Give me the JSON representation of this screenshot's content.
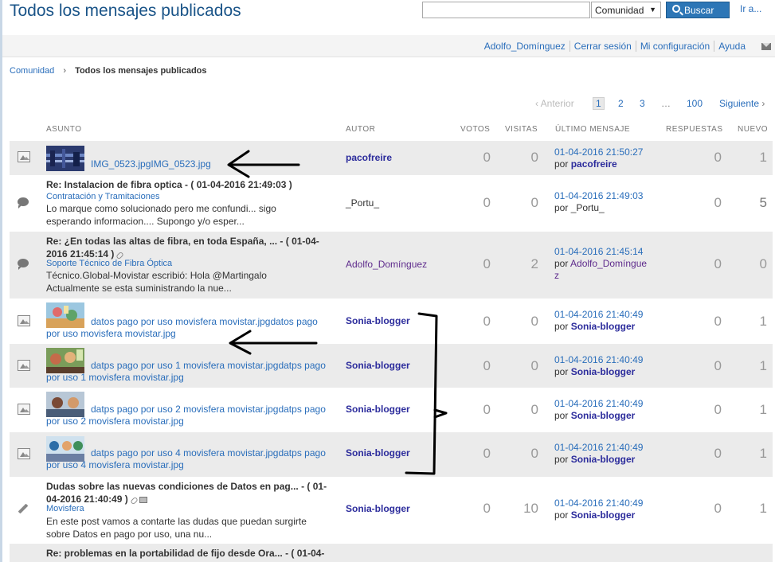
{
  "header": {
    "title": "Todos los mensajes publicados",
    "search_placeholder": "",
    "scope": "Comunidad",
    "search_button": "Buscar",
    "goto": "Ir a..."
  },
  "userbar": {
    "user": "Adolfo_Domínguez",
    "logout": "Cerrar sesión",
    "settings": "Mi configuración",
    "help": "Ayuda"
  },
  "breadcrumb": {
    "root": "Comunidad",
    "current": "Todos los mensajes publicados"
  },
  "pagination": {
    "prev": "Anterior",
    "current": "1",
    "pages": [
      "2",
      "3"
    ],
    "ellipsis": "…",
    "last": "100",
    "next": "Siguiente"
  },
  "columns": {
    "subject": "ASUNTO",
    "author": "AUTOR",
    "votes": "VOTOS",
    "views": "VISITAS",
    "last": "ÚLTIMO MENSAJE",
    "replies": "RESPUESTAS",
    "new": "NUEVO"
  },
  "rows": [
    {
      "icon": "image-icon",
      "subject": "IMG_0523.jpgIMG_0523.jpg",
      "author": "pacofreire",
      "votes": "0",
      "views": "0",
      "last_date": "01-04-2016 21:50:27",
      "by": "por",
      "last_user": "pacofreire",
      "replies": "0",
      "new": "1"
    },
    {
      "icon": "speech-bubble-icon",
      "title": "Re: Instalacion de fibra optica - ( 01-04-2016 21:49:03 )",
      "board": "Contratación y Tramitaciones",
      "snippet": "Lo marque como solucionado pero me confundi... sigo esperando informacion....   Supongo y/o esper...",
      "author": "_Portu_",
      "votes": "0",
      "views": "0",
      "last_date": "01-04-2016 21:49:03",
      "by": "por",
      "last_user": "_Portu_",
      "replies": "0",
      "new": "5"
    },
    {
      "icon": "speech-bubble-icon",
      "title_line1": "Re: ¿En todas las altas de fibra, en toda España, ... - ( 01-04-",
      "title_line2": "2016 21:45:14 )",
      "board": "Soporte Técnico de Fibra Óptica",
      "snippet": "Técnico.Global-Movistar escribió: Hola @Martingalo Actualmente se esta suministrando la nue...",
      "author": "Adolfo_Domínguez",
      "votes": "0",
      "views": "2",
      "last_date": "01-04-2016 21:45:14",
      "by": "por",
      "last_user_line1": "Adolfo_Domíngue",
      "last_user_line2": "z",
      "replies": "0",
      "new": "0"
    },
    {
      "icon": "image-icon",
      "subject_line1": "datos pago por uso movisfera movistar.jpgdatos pago",
      "subject_line2": "por uso movisfera movistar.jpg",
      "author": "Sonia-blogger",
      "votes": "0",
      "views": "0",
      "last_date": "01-04-2016 21:40:49",
      "by": "por",
      "last_user": "Sonia-blogger",
      "replies": "0",
      "new": "1"
    },
    {
      "icon": "image-icon",
      "subject_line1": "datps pago por uso 1 movisfera movistar.jpgdatps",
      "subject_line2": "pago por uso 1 movisfera movistar.jpg",
      "author": "Sonia-blogger",
      "votes": "0",
      "views": "0",
      "last_date": "01-04-2016 21:40:49",
      "by": "por",
      "last_user": "Sonia-blogger",
      "replies": "0",
      "new": "1"
    },
    {
      "icon": "image-icon",
      "subject_line1": "datps pago por uso 2 movisfera movistar.jpgdatps",
      "subject_line2": "pago por uso 2 movisfera movistar.jpg",
      "author": "Sonia-blogger",
      "votes": "0",
      "views": "0",
      "last_date": "01-04-2016 21:40:49",
      "by": "por",
      "last_user": "Sonia-blogger",
      "replies": "0",
      "new": "1"
    },
    {
      "icon": "image-icon",
      "subject_line1": "datps pago por uso 4 movisfera movistar.jpgdatps",
      "subject_line2": "pago por uso 4 movisfera movistar.jpg",
      "author": "Sonia-blogger",
      "votes": "0",
      "views": "0",
      "last_date": "01-04-2016 21:40:49",
      "by": "por",
      "last_user": "Sonia-blogger",
      "replies": "0",
      "new": "1"
    },
    {
      "icon": "pencil-icon",
      "title_line1": "Dudas sobre las nuevas condiciones de Datos en pag... - ( 01-",
      "title_line2": "04-2016 21:40:49 )",
      "board": "Movisfera",
      "snippet": "  En este post vamos a contarte las dudas que puedan surgirte sobre Datos en pago por uso, una nu...",
      "author": "Sonia-blogger",
      "votes": "0",
      "views": "10",
      "last_date": "01-04-2016 21:40:49",
      "by": "por",
      "last_user": "Sonia-blogger",
      "replies": "0",
      "new": "1"
    },
    {
      "title": "Re: problemas en la portabilidad de fijo desde Ora... - ( 01-04-"
    }
  ]
}
